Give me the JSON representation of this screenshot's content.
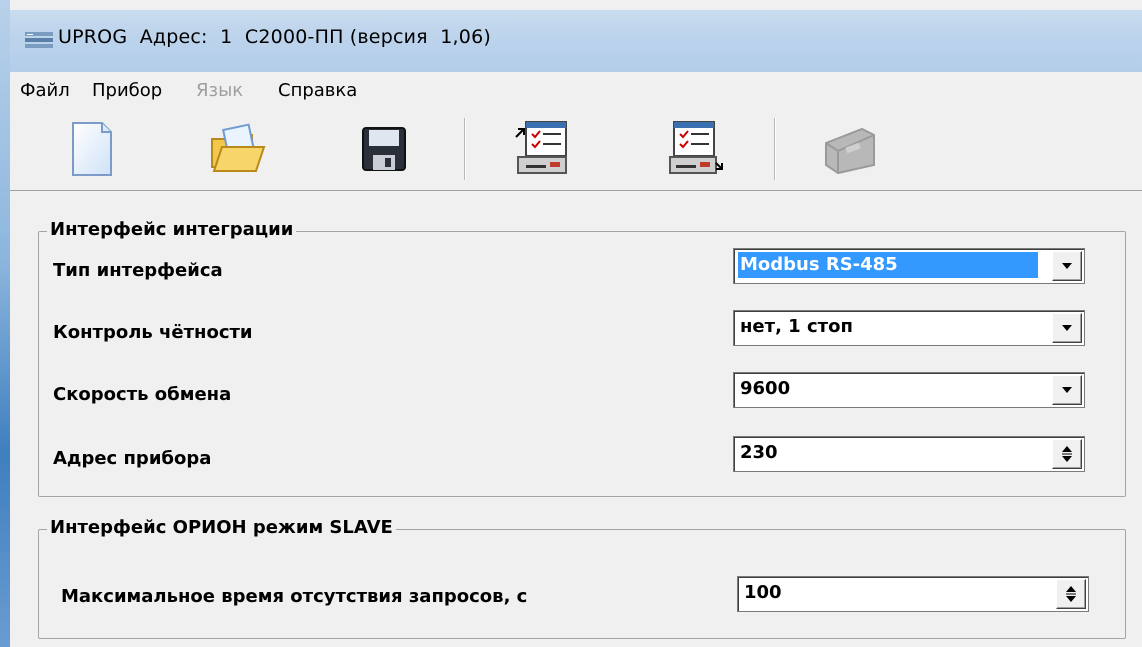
{
  "window": {
    "title": "UPROG  Адрес:  1  С2000-ПП (версия  1,06)"
  },
  "menu": {
    "items": [
      {
        "label": "Файл",
        "enabled": true
      },
      {
        "label": "Прибор",
        "enabled": true
      },
      {
        "label": "Язык",
        "enabled": false
      },
      {
        "label": "Справка",
        "enabled": true
      }
    ]
  },
  "toolbar": {
    "buttons": [
      {
        "icon": "new-file-icon",
        "enabled": true
      },
      {
        "icon": "open-folder-icon",
        "enabled": true
      },
      {
        "icon": "save-disk-icon",
        "enabled": true
      },
      {
        "icon": "read-from-device-icon",
        "enabled": true
      },
      {
        "icon": "write-to-device-icon",
        "enabled": true
      },
      {
        "icon": "device-icon",
        "enabled": false
      }
    ]
  },
  "integration": {
    "group_title": "Интерфейс интеграции",
    "interface_type": {
      "label": "Тип интерфейса",
      "value": "Modbus RS-485"
    },
    "parity": {
      "label": "Контроль чётности",
      "value": "нет, 1 стоп"
    },
    "baud_rate": {
      "label": "Скорость обмена",
      "value": "9600"
    },
    "device_address": {
      "label": "Адрес прибора",
      "value": "230"
    }
  },
  "orion": {
    "group_title": "Интерфейс ОРИОН режим SLAVE",
    "max_no_request_time": {
      "label": "Максимальное время отсутствия запросов, с",
      "value": "100"
    }
  },
  "colors": {
    "selection": "#3399ff",
    "titlebar": "#bcd3ec",
    "background": "#f0f0f0"
  }
}
